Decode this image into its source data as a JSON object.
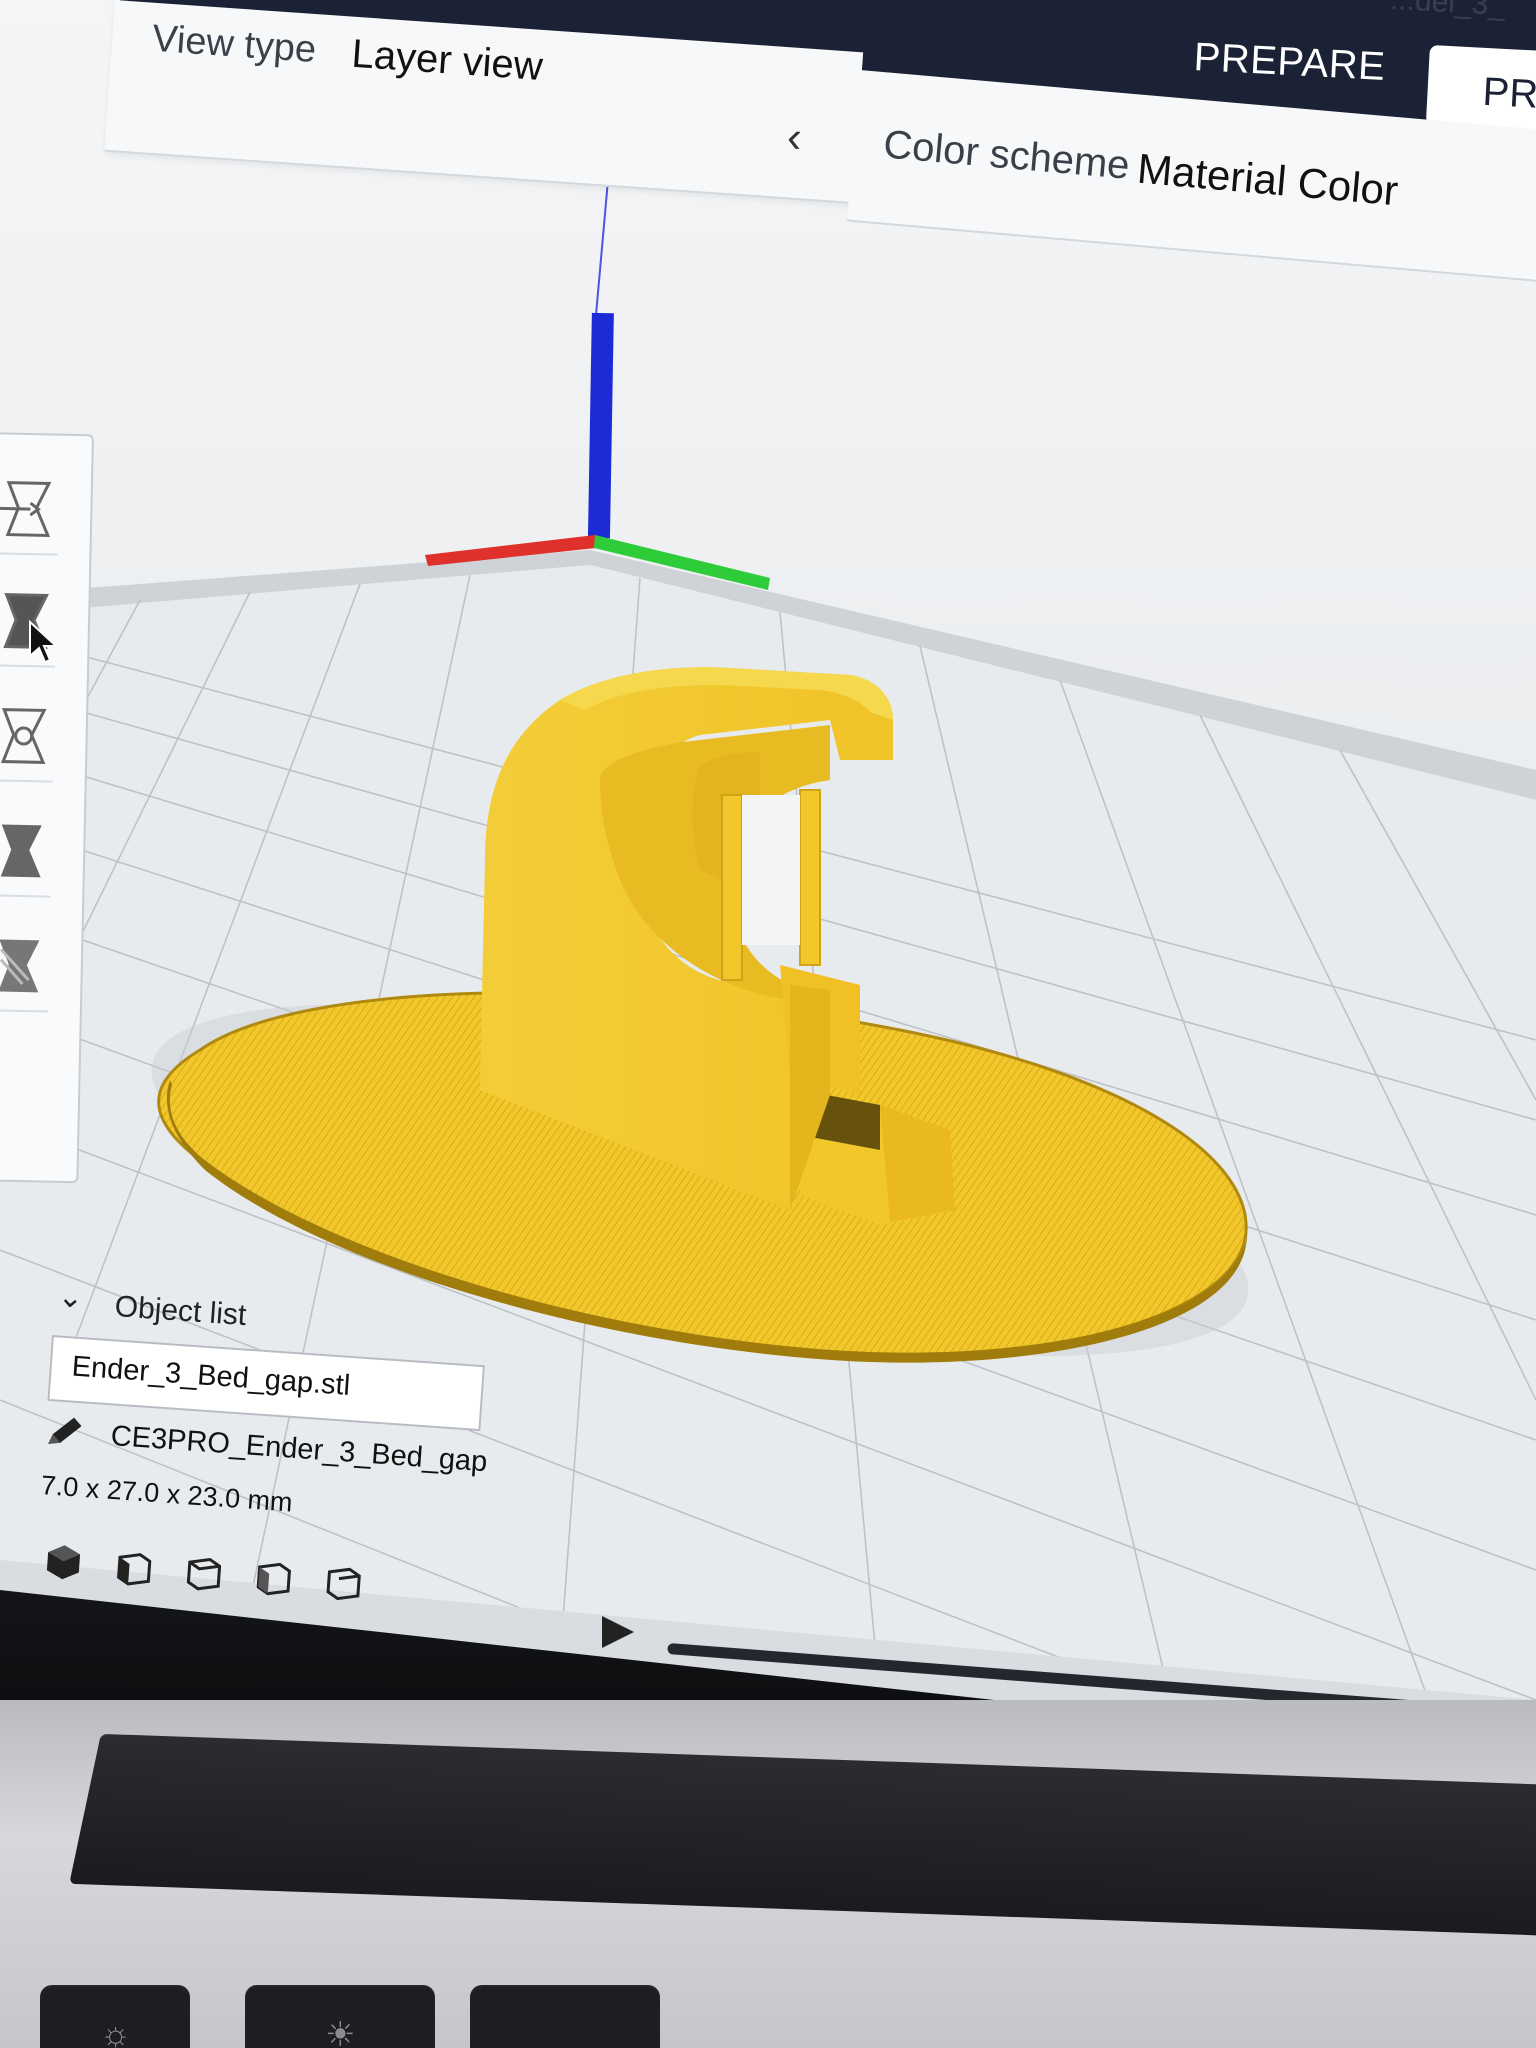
{
  "header": {
    "window_title": "...del_3_",
    "stages": [
      {
        "label": "PREPARE"
      },
      {
        "label": "PR"
      }
    ]
  },
  "view_panel": {
    "view_type_label": "View type",
    "view_type_value": "Layer view",
    "collapse_icon": "chevron-left-icon",
    "color_scheme_label": "Color scheme",
    "color_scheme_value": "Material Color"
  },
  "toolbar": {
    "tools": [
      {
        "name": "move-tool-icon"
      },
      {
        "name": "scale-tool-icon"
      },
      {
        "name": "rotate-tool-icon"
      },
      {
        "name": "mirror-tool-icon"
      },
      {
        "name": "per-model-settings-icon"
      },
      {
        "name": "support-blocker-icon"
      }
    ]
  },
  "object_list": {
    "toggle_icon": "chevron-down-icon",
    "label": "Object list",
    "file_name": "Ender_3_Bed_gap.stl",
    "job_name": "CE3PRO_Ender_3_Bed_gap",
    "dimensions": "7.0 x 27.0 x 23.0 mm",
    "camera_views": [
      {
        "name": "3d-view-icon"
      },
      {
        "name": "front-view-icon"
      },
      {
        "name": "top-view-icon"
      },
      {
        "name": "left-view-icon"
      },
      {
        "name": "right-view-icon"
      }
    ]
  },
  "layer_slider": {
    "play_icon": "play-icon"
  },
  "colors": {
    "header_bg": "#1c2235",
    "model_yellow": "#f2c72b",
    "axis_x": "#e0302b",
    "axis_y": "#2fcc3a",
    "axis_z": "#1d2bd6"
  },
  "keyboard": {
    "keys": [
      {
        "name": "brightness-icon",
        "glyph": "☼"
      },
      {
        "name": "brightness-up-icon",
        "glyph": "☀"
      }
    ]
  }
}
